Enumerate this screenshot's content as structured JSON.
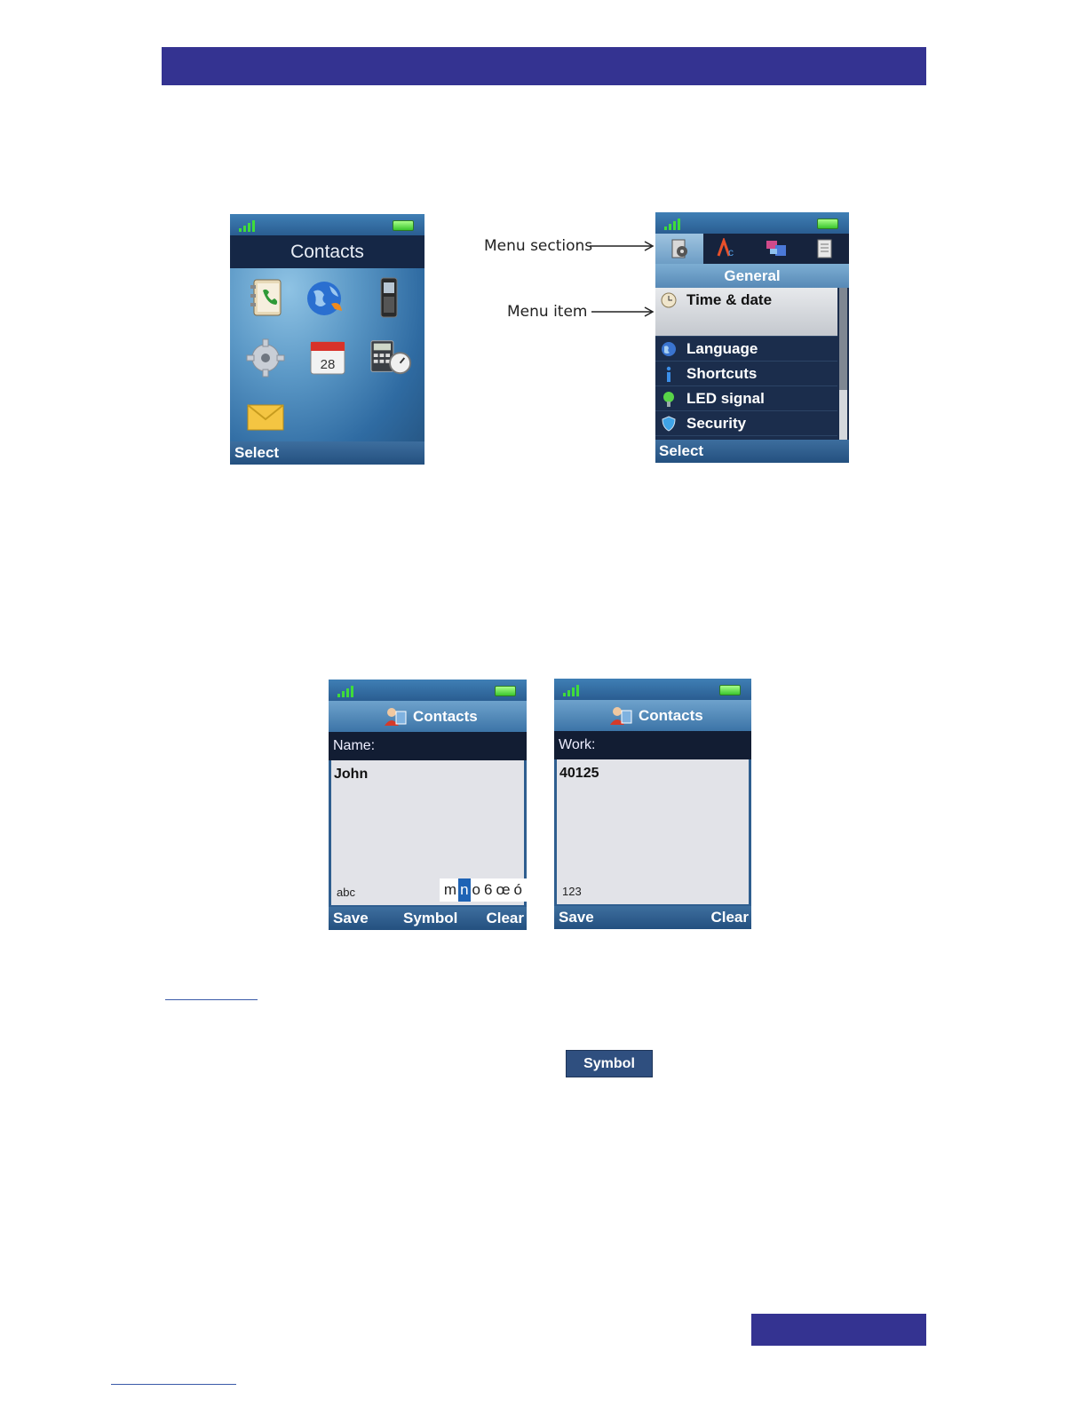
{
  "colors": {
    "header_band": "#343391",
    "link_blue": "#3a5aa8"
  },
  "phone_main_menu": {
    "title": "Contacts",
    "icons": [
      "contacts-book-icon",
      "globe-icon",
      "phone-handset-icon",
      "gear-icon",
      "calendar-icon",
      "calculator-icon",
      "envelope-icon"
    ],
    "calendar_day": "28",
    "softkey_left": "Select"
  },
  "annotations": {
    "menu_sections": "Menu sections",
    "menu_item": "Menu item"
  },
  "phone_settings": {
    "tabs": [
      "settings-icon",
      "text-style-icon",
      "theme-icon",
      "list-icon"
    ],
    "section_title": "General",
    "items": [
      {
        "label": "Time & date",
        "icon": "clock-icon"
      },
      {
        "label": "Language",
        "icon": "globe-icon"
      },
      {
        "label": "Shortcuts",
        "icon": "info-icon"
      },
      {
        "label": "LED signal",
        "icon": "led-icon"
      },
      {
        "label": "Security",
        "icon": "shield-icon"
      }
    ],
    "softkey_left": "Select"
  },
  "phone_name_entry": {
    "title": "Contacts",
    "field_label": "Name:",
    "value": "John",
    "input_mode": "abc",
    "candidates": [
      "m",
      "n",
      "o",
      "6",
      "œ",
      "ó"
    ],
    "selected_candidate": "n",
    "softkeys": {
      "left": "Save",
      "center": "Symbol",
      "right": "Clear"
    }
  },
  "phone_number_entry": {
    "title": "Contacts",
    "field_label": "Work:",
    "value": "40125",
    "input_mode": "123",
    "softkeys": {
      "left": "Save",
      "right": "Clear"
    }
  },
  "symbol_button": "Symbol"
}
